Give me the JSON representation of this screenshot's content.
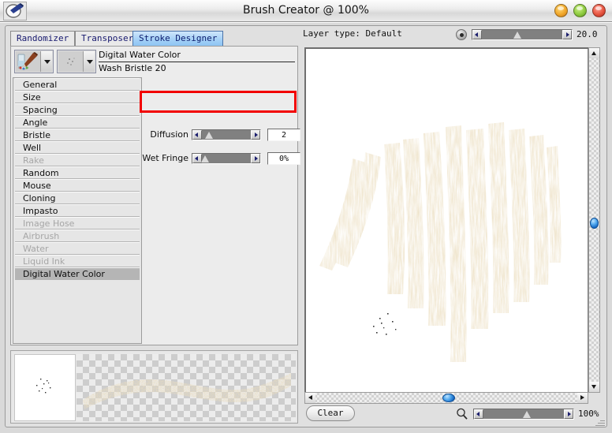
{
  "window": {
    "title": "Brush Creator @ 100%",
    "app_icon": "paint-brush-icon",
    "buttons": {
      "minimize": "minimize-button",
      "maximize": "maximize-button",
      "close": "close-button"
    }
  },
  "tabs": [
    {
      "label": "Randomizer",
      "active": false
    },
    {
      "label": "Transposer",
      "active": false
    },
    {
      "label": "Stroke Designer",
      "active": true
    }
  ],
  "header": {
    "layer_type": "Layer type: Default",
    "opacity_value": "20.0",
    "opacity_icon": "dot-icon"
  },
  "brush": {
    "category": "Digital Water Color",
    "variant": "Wash Bristle 20",
    "category_icon": "brush-palette-icon",
    "variant_icon": "dab-preview-icon"
  },
  "settings_list": [
    {
      "label": "General",
      "state": "normal"
    },
    {
      "label": "Size",
      "state": "normal"
    },
    {
      "label": "Spacing",
      "state": "normal"
    },
    {
      "label": "Angle",
      "state": "normal"
    },
    {
      "label": "Bristle",
      "state": "normal"
    },
    {
      "label": "Well",
      "state": "normal"
    },
    {
      "label": "Rake",
      "state": "disabled"
    },
    {
      "label": "Random",
      "state": "normal"
    },
    {
      "label": "Mouse",
      "state": "normal"
    },
    {
      "label": "Cloning",
      "state": "normal"
    },
    {
      "label": "Impasto",
      "state": "normal"
    },
    {
      "label": "Image Hose",
      "state": "disabled"
    },
    {
      "label": "Airbrush",
      "state": "disabled"
    },
    {
      "label": "Water",
      "state": "disabled"
    },
    {
      "label": "Liquid Ink",
      "state": "disabled"
    },
    {
      "label": "Digital Water Color",
      "state": "selected"
    }
  ],
  "parameters": [
    {
      "label": "Diffusion",
      "value": "2",
      "thumb_percent": 8,
      "highlighted": true
    },
    {
      "label": "Wet Fringe",
      "value": "0%",
      "thumb_percent": 2,
      "highlighted": false
    }
  ],
  "highlight": {
    "color": "#f20000"
  },
  "footer": {
    "clear_label": "Clear",
    "zoom_value": "100%",
    "zoom_icon": "magnifier-icon",
    "zoom_thumb_percent": 52
  },
  "canvas": {
    "vertical_scroll_thumb": "blue-oval-thumb",
    "horizontal_scroll_thumb": "blue-oval-thumb"
  }
}
